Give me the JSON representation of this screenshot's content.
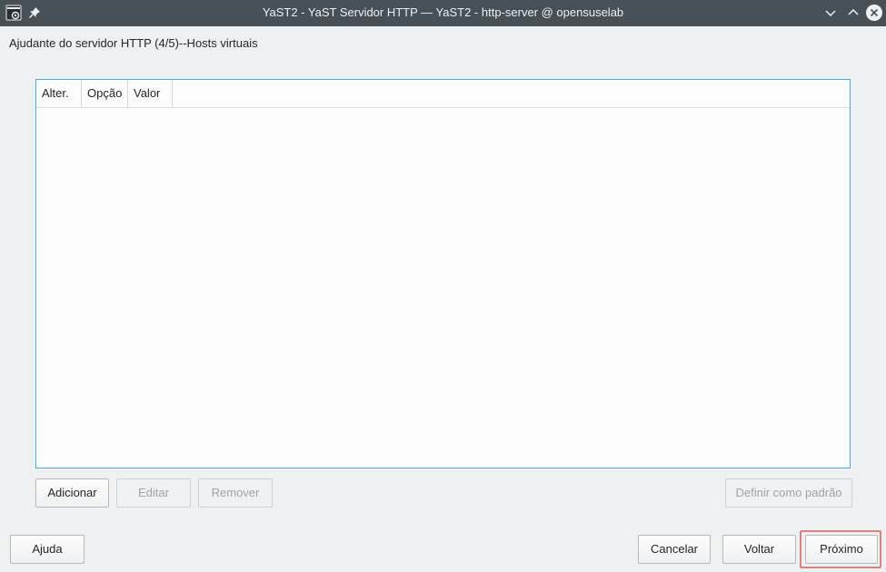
{
  "window": {
    "title": "YaST2 - YaST Servidor HTTP — YaST2 - http-server @ opensuselab",
    "icons": {
      "app": "yast-app-icon",
      "pin": "pin-icon",
      "minimize": "chevron-down-icon",
      "maximize": "chevron-up-icon",
      "close": "close-icon"
    }
  },
  "page": {
    "heading": "Ajudante do servidor HTTP (4/5)--Hosts virtuais"
  },
  "table": {
    "columns": [
      "Alter.",
      "Opção",
      "Valor"
    ],
    "rows": []
  },
  "table_actions": {
    "add": "Adicionar",
    "edit": "Editar",
    "remove": "Remover",
    "set_default": "Definir como padrão"
  },
  "footer": {
    "help": "Ajuda",
    "cancel": "Cancelar",
    "back": "Voltar",
    "next": "Próximo"
  },
  "colors": {
    "titlebar": "#475057",
    "accent": "#3daee9",
    "focus": "#e2807f"
  }
}
